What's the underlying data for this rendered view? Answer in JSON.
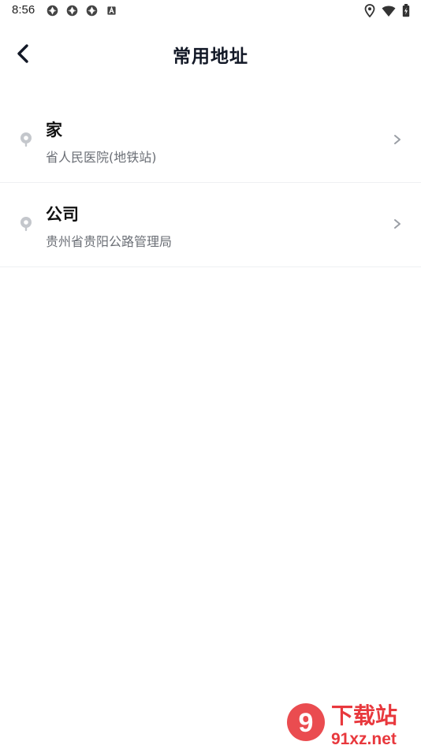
{
  "status_bar": {
    "time": "8:56",
    "left_icons": [
      "app-icon",
      "app-icon",
      "app-icon",
      "a-icon"
    ],
    "right_icons": [
      "location-icon",
      "wifi-icon",
      "battery-icon"
    ]
  },
  "header": {
    "back_icon": "chevron-left-icon",
    "title": "常用地址"
  },
  "addresses": [
    {
      "name": "家",
      "detail": "省人民医院(地铁站)"
    },
    {
      "name": "公司",
      "detail": "贵州省贵阳公路管理局"
    }
  ],
  "watermark": {
    "line1": "下载站",
    "line2": "91xz.net",
    "logo_text": "9"
  },
  "colors": {
    "title": "#121826",
    "detail": "#6b6f76",
    "divider": "#eef0f2",
    "icon_gray": "#c4c7cc",
    "watermark_red": "#e8383d"
  }
}
